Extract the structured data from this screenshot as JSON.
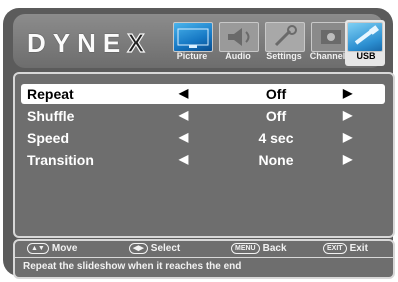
{
  "brand": {
    "logo_solid": "DYNE",
    "logo_ghost": "X"
  },
  "menu": [
    {
      "id": "picture",
      "label": "Picture",
      "icon": "picture-icon",
      "active": false
    },
    {
      "id": "audio",
      "label": "Audio",
      "icon": "audio-icon",
      "active": false
    },
    {
      "id": "settings",
      "label": "Settings",
      "icon": "settings-icon",
      "active": false
    },
    {
      "id": "channels",
      "label": "Channels",
      "icon": "channels-icon",
      "active": false
    },
    {
      "id": "usb",
      "label": "USB",
      "icon": "usb-icon",
      "active": true
    }
  ],
  "settings": [
    {
      "name": "Repeat",
      "value": "Off",
      "selected": true
    },
    {
      "name": "Shuffle",
      "value": "Off",
      "selected": false
    },
    {
      "name": "Speed",
      "value": "4 sec",
      "selected": false
    },
    {
      "name": "Transition",
      "value": "None",
      "selected": false
    }
  ],
  "footer": {
    "move_key": "▲▼",
    "move": "Move",
    "select_key": "◀▶",
    "select": "Select",
    "menu_key": "MENU",
    "back": "Back",
    "exit_key": "EXIT",
    "exit": "Exit",
    "help": "Repeat the slideshow when it reaches the end"
  },
  "colors": {
    "frame": "#5b5b5b",
    "panel": "#6e6e6e",
    "selected_row": "#ffffff",
    "accent_blue": "#1678c4"
  }
}
